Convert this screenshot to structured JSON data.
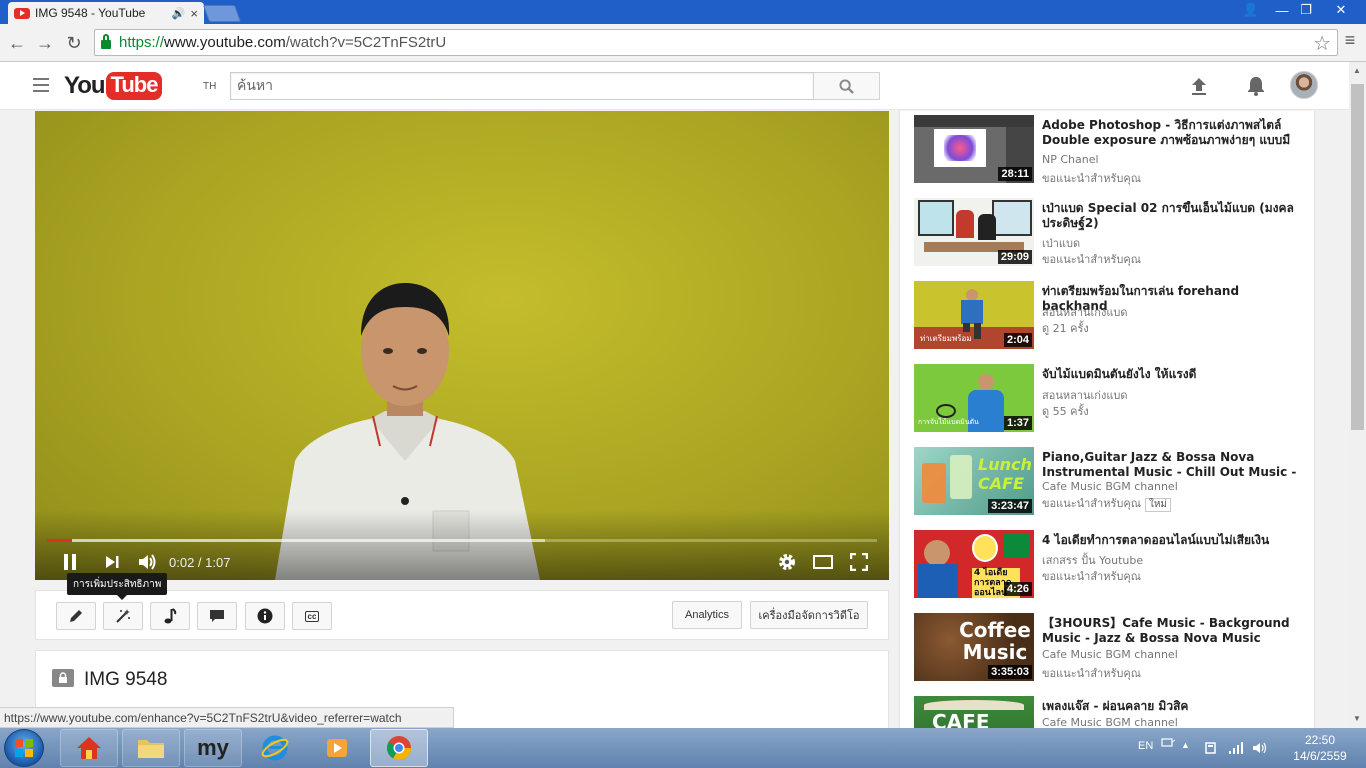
{
  "browser": {
    "tab_title": "IMG 9548 - YouTube",
    "tab_audio": "🔊",
    "tab_close": "×",
    "url_scheme": "https://",
    "url_host": "www.youtube.com",
    "url_path": "/watch?v=5C2TnFS2trU",
    "window_controls": [
      "👤",
      "—",
      "❐",
      "✕"
    ],
    "nav": {
      "back": "←",
      "forward": "→",
      "reload": "↻"
    },
    "status_url": "https://www.youtube.com/enhance?v=5C2TnFS2trU&video_referrer=watch"
  },
  "masthead": {
    "logo_you": "You",
    "logo_tube": "Tube",
    "logo_region": "TH",
    "search_placeholder": "ค้นหา",
    "icons": [
      "guide-icon",
      "search-icon",
      "upload-icon",
      "bell-icon",
      "avatar"
    ]
  },
  "player": {
    "time": "0:02 / 1:07",
    "progress_played": 0.03,
    "progress_buffered": 0.6,
    "state": "playing",
    "tooltip": "การเพิ่มประสิทธิภาพ"
  },
  "creator_bar": {
    "analytics_label": "Analytics",
    "video_manager_label": "เครื่องมือจัดการวิดีโอ",
    "cc_label": "cc"
  },
  "video": {
    "title": "IMG 9548",
    "privacy": "private"
  },
  "recommendations": [
    {
      "title": "Adobe Photoshop - วิธีการแต่งภาพสไตล์ Double exposure ภาพซ้อนภาพง่ายๆ แบบมื",
      "channel": "NP Chanel",
      "meta": "ขอแนะนำสำหรับคุณ",
      "duration": "28:11",
      "new": ""
    },
    {
      "title": "เป่าแบด Special 02 การขึ้นเอ็นไม้แบด (มงคล ประดิษฐ์2)",
      "channel": "เป่าแบด",
      "meta": "ขอแนะนำสำหรับคุณ",
      "duration": "29:09",
      "new": ""
    },
    {
      "title": "ท่าเตรียมพร้อมในการเล่น forehand backhand",
      "channel": "สอนหลานเก่งแบด",
      "meta": "ดู 21 ครั้ง",
      "duration": "2:04",
      "thumb_caption": "ท่าเตรียมพร้อม",
      "new": ""
    },
    {
      "title": "จับไม้แบดมินตันยังไง ให้แรงดี",
      "channel": "สอนหลานเก่งแบด",
      "meta": "ดู 55 ครั้ง",
      "duration": "1:37",
      "thumb_caption": "การจับไม้แบดมินตัน",
      "new": ""
    },
    {
      "title": "Piano,Guitar Jazz & Bossa Nova Instrumental Music - Chill Out Music -",
      "channel": "Cafe Music BGM channel",
      "meta": "ขอแนะนำสำหรับคุณ",
      "duration": "3:23:47",
      "thumb_caption": "Lunch CAFE",
      "new": "ใหม่"
    },
    {
      "title": "4 ไอเดียทำการตลาดออนไลน์แบบไม่เสียเงิน",
      "channel": "เสกสรร ปั้น Youtube",
      "meta": "ขอแนะนำสำหรับคุณ",
      "duration": "4:26",
      "thumb_caption": "4 ไอเดีย การตลาดออนไลน์",
      "new": ""
    },
    {
      "title": "【3HOURS】Cafe Music - Background Music - Jazz & Bossa Nova Music",
      "channel": "Cafe Music BGM channel",
      "meta": "ขอแนะนำสำหรับคุณ",
      "duration": "3:35:03",
      "thumb_caption": "Coffee Music",
      "new": ""
    },
    {
      "title": "เพลงแจ๊ส - ผ่อนคลาย มิวสิค",
      "channel": "Cafe Music BGM channel",
      "meta": "",
      "duration": "",
      "thumb_caption": "CAFE",
      "new": ""
    }
  ],
  "taskbar": {
    "language": "EN",
    "time": "22:50",
    "date": "14/6/2559",
    "my_label": "my",
    "items": [
      "start-orb",
      "home-app",
      "file-explorer",
      "my-app",
      "internet-explorer",
      "media-player",
      "chrome"
    ]
  },
  "colors": {
    "youtube_red": "#e52d27",
    "titlebar_blue": "#1f5fc7",
    "video_yellow": "#b2ab23",
    "secure_green": "#0a8a2f"
  }
}
